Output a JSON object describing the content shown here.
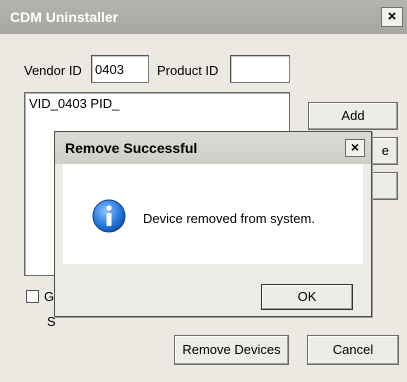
{
  "window": {
    "title": "CDM Uninstaller",
    "close_symbol": "×"
  },
  "form": {
    "vendor_id_label": "Vendor ID",
    "vendor_id_value": "0403",
    "product_id_label": "Product ID",
    "product_id_value": ""
  },
  "device_list": {
    "items": [
      "VID_0403 PID_"
    ]
  },
  "buttons": {
    "add": "Add",
    "remove_partial": "e",
    "remove_devices": "Remove Devices",
    "cancel": "Cancel"
  },
  "options": {
    "generate_log_partial": "G",
    "status_partial": "S"
  },
  "dialog": {
    "title": "Remove Successful",
    "close_symbol": "×",
    "message": "Device removed from system.",
    "ok": "OK"
  },
  "colors": {
    "title_bar": "#aeaca7",
    "info_icon": "#1f6fd1"
  }
}
